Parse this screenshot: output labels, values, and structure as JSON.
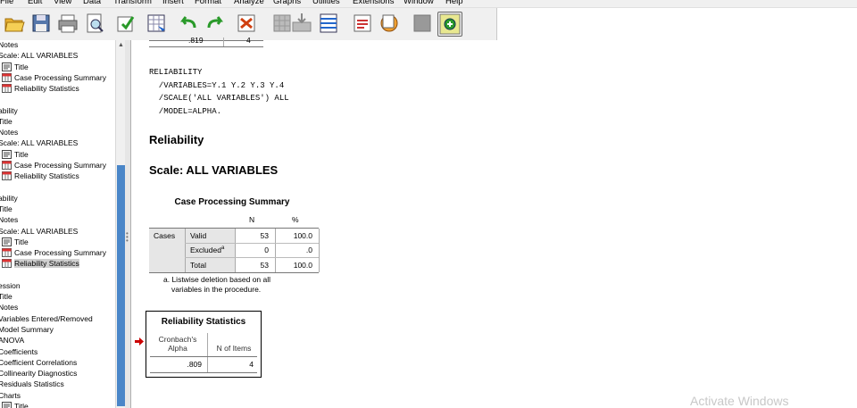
{
  "menu": [
    "File",
    "Edit",
    "View",
    "Data",
    "Transform",
    "Insert",
    "Format",
    "Analyze",
    "Graphs",
    "Utilities",
    "Extensions",
    "Window",
    "Help"
  ],
  "toolbar_icons": [
    "open-folder-icon",
    "save-icon",
    "print-icon",
    "print-preview-icon",
    "export-icon",
    "go-to-data-icon",
    "undo-icon",
    "redo-icon",
    "go-to-case-icon",
    "go-to-variable-icon",
    "insert-cases-icon",
    "variables-icon",
    "create-title-icon",
    "designate-window-icon",
    "show-all-icon",
    "promote-icon",
    "demote-icon"
  ],
  "outline": [
    {
      "text": "Notes",
      "icon": null,
      "indent": 0
    },
    {
      "text": "Scale: ALL VARIABLES",
      "icon": null,
      "indent": 0
    },
    {
      "text": "Title",
      "icon": "title-icon",
      "indent": 1
    },
    {
      "text": "Case Processing Summary",
      "icon": "table-icon",
      "indent": 1
    },
    {
      "text": "Reliability Statistics",
      "icon": "table-icon",
      "indent": 1
    },
    {
      "text": "",
      "icon": null,
      "indent": 0
    },
    {
      "text": "ability",
      "icon": null,
      "indent": 0
    },
    {
      "text": "Title",
      "icon": null,
      "indent": 0
    },
    {
      "text": "Notes",
      "icon": null,
      "indent": 0
    },
    {
      "text": "Scale: ALL VARIABLES",
      "icon": null,
      "indent": 0
    },
    {
      "text": "Title",
      "icon": "title-icon",
      "indent": 1
    },
    {
      "text": "Case Processing Summary",
      "icon": "table-icon",
      "indent": 1
    },
    {
      "text": "Reliability Statistics",
      "icon": "table-icon",
      "indent": 1
    },
    {
      "text": "",
      "icon": null,
      "indent": 0
    },
    {
      "text": "ability",
      "icon": null,
      "indent": 0
    },
    {
      "text": "Title",
      "icon": null,
      "indent": 0
    },
    {
      "text": "Notes",
      "icon": null,
      "indent": 0
    },
    {
      "text": "Scale: ALL VARIABLES",
      "icon": null,
      "indent": 0
    },
    {
      "text": "Title",
      "icon": "title-icon",
      "indent": 1
    },
    {
      "text": "Case Processing Summary",
      "icon": "table-icon",
      "indent": 1
    },
    {
      "text": "Reliability Statistics",
      "icon": "table-icon",
      "indent": 1,
      "selected": true
    },
    {
      "text": "",
      "icon": null,
      "indent": 0
    },
    {
      "text": "ession",
      "icon": null,
      "indent": 0
    },
    {
      "text": "Title",
      "icon": null,
      "indent": 0
    },
    {
      "text": "Notes",
      "icon": null,
      "indent": 0
    },
    {
      "text": "Variables Entered/Removed",
      "icon": null,
      "indent": 0
    },
    {
      "text": "Model Summary",
      "icon": null,
      "indent": 0
    },
    {
      "text": "ANOVA",
      "icon": null,
      "indent": 0
    },
    {
      "text": "Coefficients",
      "icon": null,
      "indent": 0
    },
    {
      "text": "Coefficient Correlations",
      "icon": null,
      "indent": 0
    },
    {
      "text": "Collinearity Diagnostics",
      "icon": null,
      "indent": 0
    },
    {
      "text": "Residuals Statistics",
      "icon": null,
      "indent": 0
    },
    {
      "text": "Charts",
      "icon": null,
      "indent": 0
    },
    {
      "text": "Title",
      "icon": "title-icon",
      "indent": 1
    }
  ],
  "viewer": {
    "prev_table": {
      "alpha": ".819",
      "items": "4"
    },
    "syntax": [
      "RELIABILITY",
      "  /VARIABLES=Y.1 Y.2 Y.3 Y.4",
      "  /SCALE('ALL VARIABLES') ALL",
      "  /MODEL=ALPHA."
    ],
    "heading": "Reliability",
    "scale_heading": "Scale: ALL VARIABLES",
    "case_summary": {
      "title": "Case Processing Summary",
      "col_n": "N",
      "col_pct": "%",
      "row_group": "Cases",
      "rows": [
        {
          "label": "Valid",
          "sup": "",
          "n": "53",
          "pct": "100.0"
        },
        {
          "label": "Excluded",
          "sup": "a",
          "n": "0",
          "pct": ".0"
        },
        {
          "label": "Total",
          "sup": "",
          "n": "53",
          "pct": "100.0"
        }
      ],
      "footnote_1": "a. Listwise deletion based on all",
      "footnote_2": "variables in the procedure."
    },
    "reliability": {
      "title": "Reliability Statistics",
      "col1_line1": "Cronbach's",
      "col1_line2": "Alpha",
      "col2": "N of Items",
      "alpha": ".809",
      "items": "4"
    },
    "watermark": "Activate Windows"
  },
  "colors": {
    "selection_arrow": "#cc0000",
    "scroll_thumb": "#4a86c8",
    "shade": "#e6e6e6"
  }
}
